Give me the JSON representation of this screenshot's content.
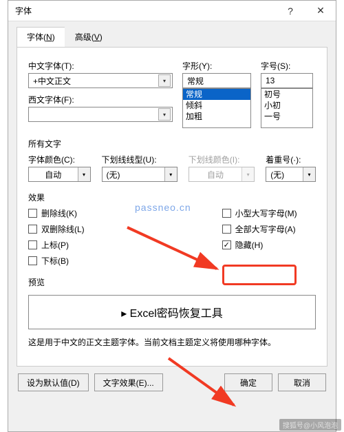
{
  "dialog": {
    "title": "字体",
    "help_icon": "?",
    "close_icon": "✕"
  },
  "tabs": {
    "font": {
      "label": "字体",
      "hotkey": "N"
    },
    "advanced": {
      "label": "高级",
      "hotkey": "V"
    }
  },
  "fields": {
    "cn_font_label": "中文字体(T):",
    "cn_font_value": "+中文正文",
    "west_font_label": "西文字体(F):",
    "style_label": "字形(Y):",
    "style_value": "常规",
    "style_options": [
      "常规",
      "倾斜",
      "加粗"
    ],
    "size_label": "字号(S):",
    "size_value": "13",
    "size_options": [
      "初号",
      "小初",
      "一号"
    ]
  },
  "all_text": {
    "group": "所有文字",
    "font_color_label": "字体颜色(C):",
    "font_color_value": "自动",
    "underline_style_label": "下划线线型(U):",
    "underline_style_value": "(无)",
    "underline_color_label": "下划线颜色(I):",
    "underline_color_value": "自动",
    "emphasis_label": "着重号(·):",
    "emphasis_value": "(无)"
  },
  "effects": {
    "group": "效果",
    "strike": "删除线(K)",
    "dstrike": "双删除线(L)",
    "superscript": "上标(P)",
    "subscript": "下标(B)",
    "smallcaps": "小型大写字母(M)",
    "allcaps": "全部大写字母(A)",
    "hidden": "隐藏(H)"
  },
  "preview": {
    "group": "预览",
    "sample": "▸ Excel密码恢复工具",
    "note": "这是用于中文的正文主题字体。当前文档主题定义将使用哪种字体。"
  },
  "footer": {
    "default_btn": "设为默认值(D)",
    "text_effects_btn": "文字效果(E)...",
    "ok": "确定",
    "cancel": "取消"
  },
  "watermark": "passneo.cn",
  "credit": "搜狐号@小风泡泡"
}
